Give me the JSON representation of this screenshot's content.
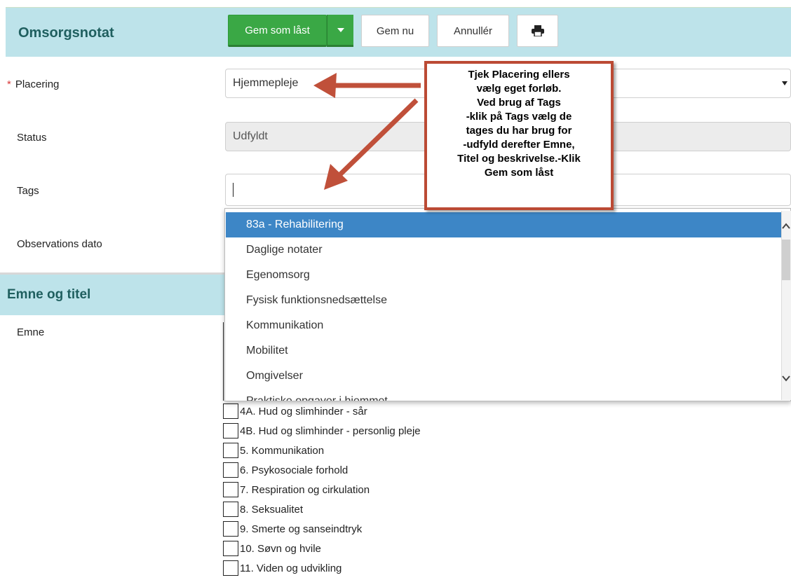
{
  "header": {
    "title": "Omsorgsnotat",
    "buttons": {
      "save_locked": "Gem som låst",
      "save_now": "Gem nu",
      "cancel": "Annullér"
    }
  },
  "form": {
    "placering": {
      "label": "Placering",
      "required_mark": "*",
      "value": "Hjemmepleje"
    },
    "status": {
      "label": "Status",
      "value": "Udfyldt"
    },
    "tags": {
      "label": "Tags",
      "value": ""
    },
    "observations": {
      "label": "Observations dato"
    }
  },
  "section": {
    "title": "Emne og titel",
    "emne_label": "Emne"
  },
  "dropdown": {
    "items": [
      {
        "label": "83a - Rehabilitering",
        "selected": true
      },
      {
        "label": "Daglige notater"
      },
      {
        "label": "Egenomsorg"
      },
      {
        "label": "Fysisk funktionsnedsættelse"
      },
      {
        "label": "Kommunikation"
      },
      {
        "label": "Mobilitet"
      },
      {
        "label": "Omgivelser"
      },
      {
        "label": "Praktiske opgaver i hjemmet"
      }
    ]
  },
  "checklist": [
    "4A. Hud og slimhinder - sår",
    "4B. Hud og slimhinder - personlig pleje",
    "5. Kommunikation",
    "6. Psykosociale forhold",
    "7. Respiration og cirkulation",
    "8. Seksualitet",
    "9. Smerte og sanseindtryk",
    "10. Søvn og hvile",
    "11. Viden og udvikling"
  ],
  "callout": {
    "lines": [
      "Tjek Placering ellers",
      "vælg eget forløb.",
      "Ved brug af Tags",
      "-klik på Tags vælg de",
      "tages du har brug for",
      "-udfyld derefter Emne,",
      "Titel og beskrivelse.-Klik",
      "Gem som låst"
    ]
  },
  "colors": {
    "header_bg": "#bde3ea",
    "primary_green": "#3aa845",
    "selected_blue": "#3d86c6",
    "callout_border": "#bb4a34",
    "required": "#d83a3a"
  },
  "icons": {
    "print": "printer-icon",
    "caret": "caret-down-icon",
    "arrow": "annotation-arrow"
  }
}
